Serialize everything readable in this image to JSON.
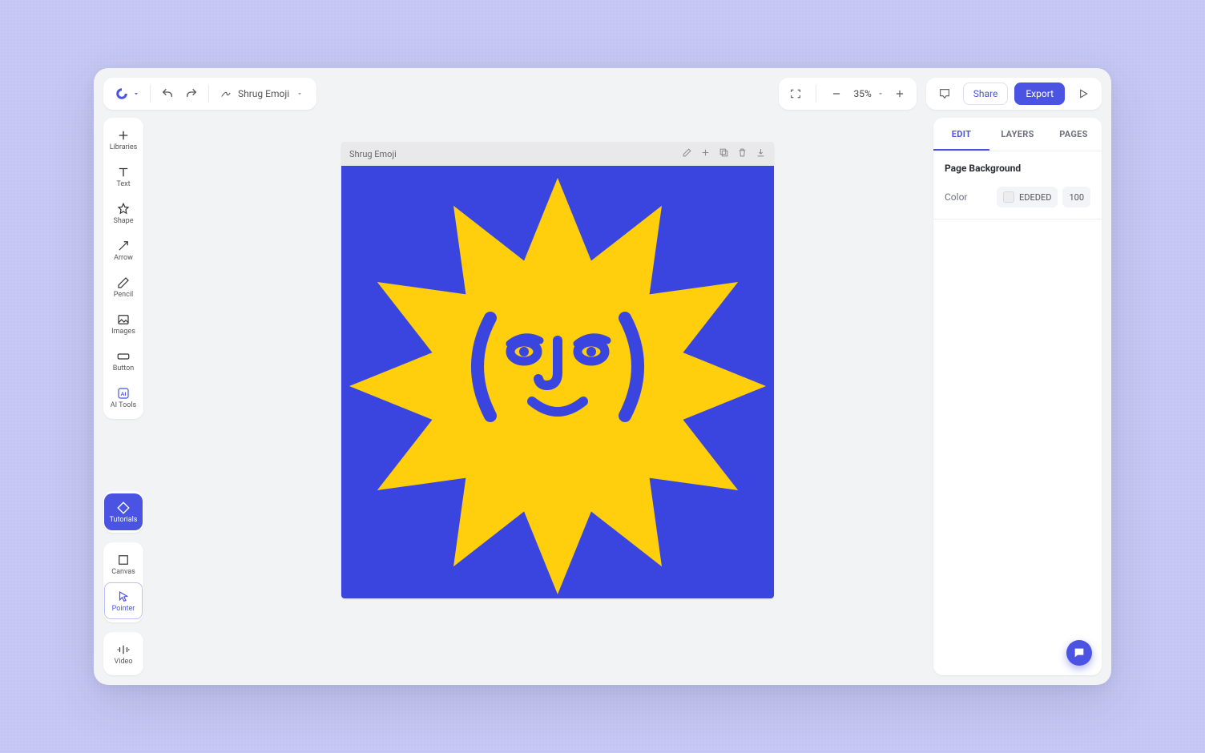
{
  "header": {
    "document_title": "Shrug Emoji",
    "zoom": "35%",
    "share_label": "Share",
    "export_label": "Export"
  },
  "tools": {
    "libraries": "Libraries",
    "text": "Text",
    "shape": "Shape",
    "arrow": "Arrow",
    "pencil": "Pencil",
    "images": "Images",
    "button": "Button",
    "ai_tools": "AI Tools",
    "tutorials": "Tutorials",
    "canvas": "Canvas",
    "pointer": "Pointer",
    "video": "Video"
  },
  "tabs": {
    "edit": "EDIT",
    "layers": "LAYERS",
    "pages": "PAGES"
  },
  "panel": {
    "page_background": "Page Background",
    "color_label": "Color",
    "color_hex": "EDEDED",
    "opacity": "100"
  },
  "artboard": {
    "title": "Shrug Emoji",
    "bg_color": "#3a45df",
    "star_color": "#ffcf0d",
    "face_color": "#3a45df"
  }
}
